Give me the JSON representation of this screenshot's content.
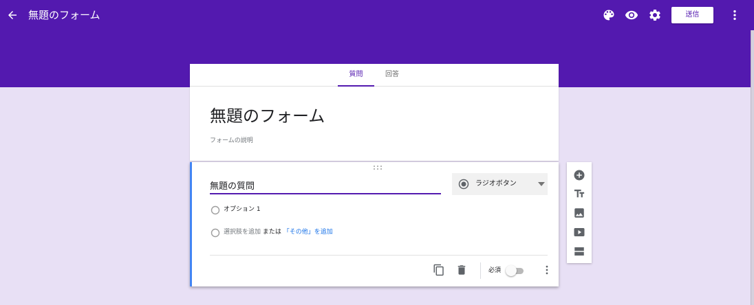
{
  "header": {
    "title": "無題のフォーム",
    "send_label": "送信",
    "icons": [
      "back-arrow-icon",
      "palette-icon",
      "eye-icon",
      "gear-icon",
      "more-vert-icon"
    ]
  },
  "tabs": {
    "questions": "質問",
    "responses": "回答"
  },
  "form": {
    "title": "無題のフォーム",
    "description_placeholder": "フォームの説明"
  },
  "question": {
    "title": "無題の質問",
    "type": "ラジオボタン",
    "options": [
      "オプション 1"
    ],
    "add_option": "選択肢を追加",
    "or_text": " または ",
    "add_other": "「その他」を追加",
    "required_label": "必須",
    "required": false
  },
  "side_tools": [
    "add-circle-icon",
    "text-title-icon",
    "image-icon",
    "video-icon",
    "section-icon"
  ],
  "colors": {
    "header": "#5319af",
    "background": "#e8e0f5",
    "accent_blue": "#4285f4",
    "link": "#1a73e8"
  }
}
